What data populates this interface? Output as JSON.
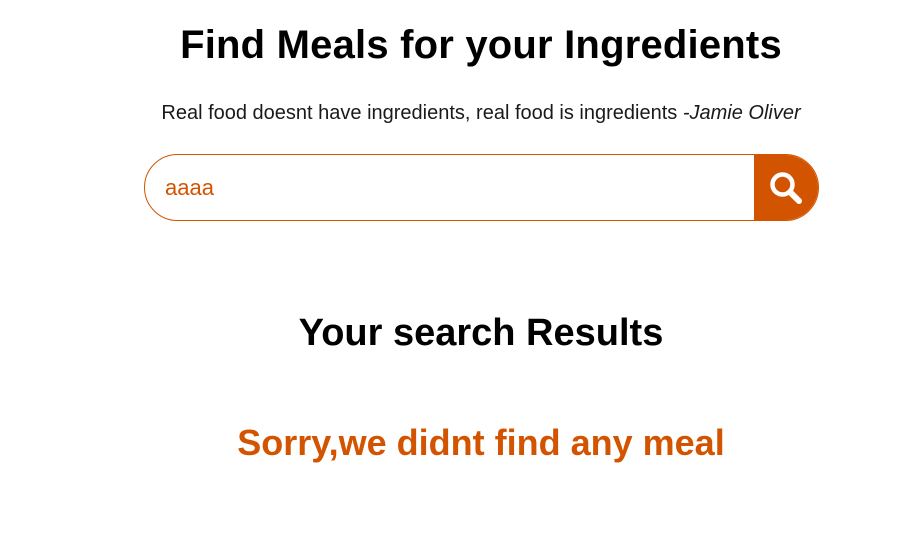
{
  "header": {
    "title": "Find Meals for your Ingredients",
    "quote_text": "Real food doesnt have ingredients, real food is ingredients ",
    "quote_author": "-Jamie Oliver"
  },
  "search": {
    "value": "aaaa",
    "button_icon": "search-icon"
  },
  "results": {
    "heading": "Your search Results",
    "empty_message": "Sorry,we didnt find any meal"
  },
  "colors": {
    "accent": "#d35400",
    "text": "#000000",
    "background": "#ffffff"
  }
}
